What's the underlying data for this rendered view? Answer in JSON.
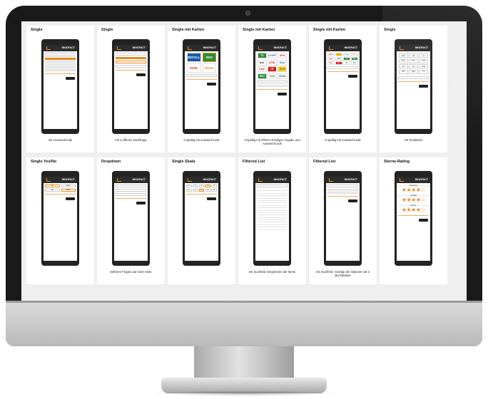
{
  "colors": {
    "accent": "#e8891a",
    "bezel": "#1a1a1a",
    "screen_bg": "#efefef"
  },
  "brand": {
    "main": "INNOFACT",
    "accent": ""
  },
  "cards": [
    {
      "title": "Single",
      "caption": "mit Ausweichcode"
    },
    {
      "title": "Single",
      "caption": "mit 2 offenen Nachfrage"
    },
    {
      "title": "Single mit Karten",
      "caption": "2-spaltig mit Ausweichcode"
    },
    {
      "title": "Single mit Karten",
      "caption": "3-spaltig mit offener sonstiger Angabe und Ausweichcode"
    },
    {
      "title": "Single mit Karten",
      "caption": "4-spaltig mit Ausweichcode"
    },
    {
      "title": "Single",
      "caption": "mit Textkarten"
    },
    {
      "title": "Single Yes/No",
      "caption": ""
    },
    {
      "title": "Dropdown",
      "caption": "Mehrere Fragen auf einer Seite"
    },
    {
      "title": "Single Skala",
      "caption": ""
    },
    {
      "title": "Filtered List",
      "caption": "mit Suchfeld, Eingrenzen der Items"
    },
    {
      "title": "Filtered List",
      "caption": "mit Suchfeld, Anzeige der Optionen ab 2 Buchstaben"
    },
    {
      "title": "Sterne-Rating",
      "caption": ""
    }
  ],
  "logos_2col": [
    "MOTALL",
    "EKO",
    "AVOIL",
    "OKtan"
  ],
  "logos_3col": [
    "TS",
    "LOVEY",
    "AVIA",
    "prio",
    "AVOIL",
    "Esso",
    "Diem",
    "HT",
    "EVO",
    "EKO",
    "Shell",
    "OKtan"
  ],
  "logos_4col": [
    "AVOIL",
    "Shell",
    "Esso",
    "OKtan",
    "prio",
    "AVIA",
    "TS",
    "EKO",
    "Diem",
    "HT",
    "BP",
    "Aral"
  ],
  "text_tiles": [
    "AVIA",
    "Aral",
    "eni",
    "Esso",
    "prio",
    "Total",
    "avo",
    "Jet",
    "Shell",
    "BP",
    "Agip",
    "TS"
  ],
  "yn_labels": [
    "Ja",
    "Nein"
  ],
  "scale_labels": [
    "1",
    "2",
    "3",
    "4",
    "5"
  ],
  "rating": {
    "stars": "★★★★☆",
    "labels": [
      "Sauberkeit",
      "Qualität",
      "Service"
    ]
  }
}
